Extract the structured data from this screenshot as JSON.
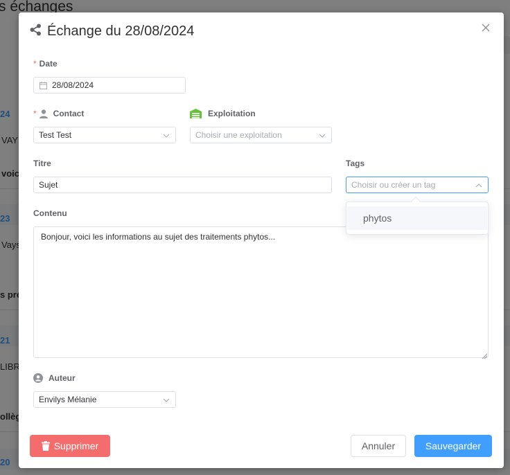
{
  "background": {
    "title": "s échanges",
    "dates": [
      "24",
      "23",
      "21",
      "20"
    ],
    "cells": [
      "VAY",
      "voic",
      "Vays",
      "s pré",
      "LIBR",
      "ollègu"
    ]
  },
  "dialog": {
    "title": "Échange du 28/08/2024",
    "fields": {
      "date": {
        "label": "Date",
        "value": "28/08/2024"
      },
      "contact": {
        "label": "Contact",
        "value": "Test Test"
      },
      "exploitation": {
        "label": "Exploitation",
        "placeholder": "Choisir une exploitation"
      },
      "titre": {
        "label": "Titre",
        "value": "Sujet"
      },
      "tags": {
        "label": "Tags",
        "placeholder": "Choisir ou créer un tag",
        "options": [
          "phytos"
        ]
      },
      "contenu": {
        "label": "Contenu",
        "value": "Bonjour, voici les informations au sujet des traitements phytos..."
      },
      "auteur": {
        "label": "Auteur",
        "value": "Envilys Mélanie"
      }
    },
    "buttons": {
      "delete": "Supprimer",
      "cancel": "Annuler",
      "save": "Sauvegarder"
    },
    "colors": {
      "primary": "#409eff",
      "danger": "#f56c6c",
      "exploitation_icon": "#67c23a",
      "required": "#f56c6c"
    }
  }
}
